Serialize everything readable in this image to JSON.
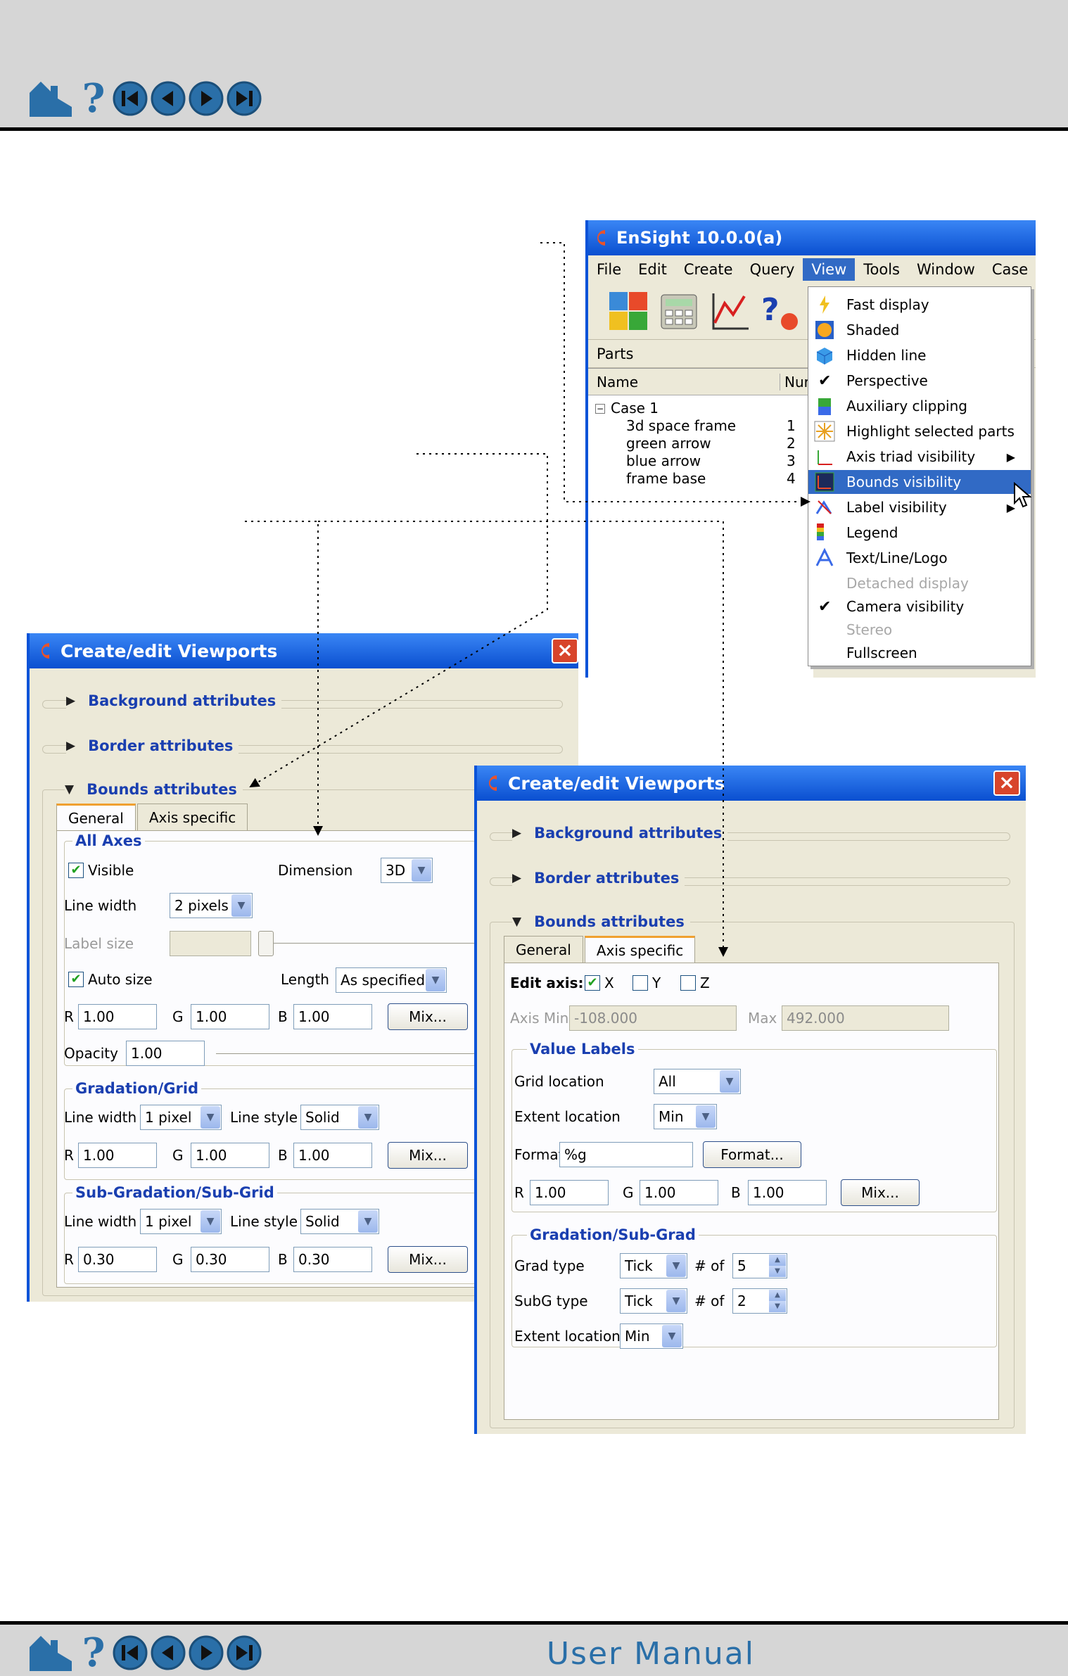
{
  "footer": {
    "title": "User Manual"
  },
  "ensight": {
    "title": "EnSight 10.0.0(a)",
    "menu": [
      "File",
      "Edit",
      "Create",
      "Query",
      "View",
      "Tools",
      "Window",
      "Case"
    ],
    "active_menu": "View",
    "parts_label": "Parts",
    "columns": {
      "name": "Name",
      "num": "Nur"
    },
    "tree": {
      "case": "Case 1",
      "parts": [
        {
          "name": "3d space frame",
          "num": "1"
        },
        {
          "name": "green arrow",
          "num": "2"
        },
        {
          "name": "blue arrow",
          "num": "3"
        },
        {
          "name": "frame base",
          "num": "4"
        }
      ]
    },
    "view_menu": [
      {
        "label": "Fast display",
        "icon": "lightning-icon"
      },
      {
        "label": "Shaded",
        "icon": "shaded-icon"
      },
      {
        "label": "Hidden line",
        "icon": "hidden-line-icon"
      },
      {
        "label": "Perspective",
        "check": "✔"
      },
      {
        "label": "Auxiliary clipping",
        "icon": "clipping-icon"
      },
      {
        "label": "Highlight selected parts",
        "icon": "highlight-icon"
      },
      {
        "label": "Axis triad visibility",
        "icon": "axis-triad-icon",
        "sub": "▶"
      },
      {
        "label": "Bounds visibility",
        "icon": "bounds-icon",
        "selected": true
      },
      {
        "label": "Label visibility",
        "icon": "label-icon",
        "sub": "▶"
      },
      {
        "label": "Legend",
        "icon": "legend-icon"
      },
      {
        "label": "Text/Line/Logo",
        "icon": "text-line-logo-icon"
      },
      {
        "label": "Detached display",
        "disabled": true
      },
      {
        "label": "Camera visibility",
        "check": "✔"
      },
      {
        "label": "Stereo",
        "disabled": true
      },
      {
        "label": "Fullscreen"
      }
    ]
  },
  "dialog_general": {
    "title": "Create/edit Viewports",
    "sections": {
      "background": "Background attributes",
      "border": "Border attributes",
      "bounds": "Bounds attributes"
    },
    "tabs": [
      "General",
      "Axis specific"
    ],
    "all_axes": {
      "title": "All Axes",
      "visible": "Visible",
      "dimension_label": "Dimension",
      "dimension": "3D",
      "line_width_label": "Line width",
      "line_width": "2 pixels",
      "label_size": "Label size",
      "auto_size": "Auto size",
      "length_label": "Length",
      "length": "As specified",
      "r": "1.00",
      "g": "1.00",
      "b": "1.00",
      "mix": "Mix...",
      "opacity_label": "Opacity",
      "opacity": "1.00"
    },
    "gradation": {
      "title": "Gradation/Grid",
      "line_width_label": "Line width",
      "line_width": "1 pixel",
      "line_style_label": "Line style",
      "line_style": "Solid",
      "r": "1.00",
      "g": "1.00",
      "b": "1.00",
      "mix": "Mix..."
    },
    "sub_gradation": {
      "title": "Sub-Gradation/Sub-Grid",
      "line_width_label": "Line width",
      "line_width": "1 pixel",
      "line_style_label": "Line style",
      "line_style": "Solid",
      "r": "0.30",
      "g": "0.30",
      "b": "0.30",
      "mix": "Mix..."
    }
  },
  "dialog_axis": {
    "title": "Create/edit Viewports",
    "sections": {
      "background": "Background attributes",
      "border": "Border attributes",
      "bounds": "Bounds attributes"
    },
    "tabs": [
      "General",
      "Axis specific"
    ],
    "edit_axis": "Edit axis:",
    "axes": [
      "X",
      "Y",
      "Z"
    ],
    "axis_min_label": "Axis Min",
    "axis_min": "-108.000",
    "max_label": "Max",
    "max": "492.000",
    "value_labels": {
      "title": "Value Labels",
      "grid_location_label": "Grid location",
      "grid_location": "All",
      "extent_location_label": "Extent location",
      "extent_location": "Min",
      "format_label": "Format",
      "format": "%g",
      "format_button": "Format...",
      "r": "1.00",
      "g": "1.00",
      "b": "1.00",
      "mix": "Mix..."
    },
    "gradation": {
      "title": "Gradation/Sub-Grad",
      "grad_type_label": "Grad type",
      "grad_type": "Tick",
      "of_label": "# of",
      "grad_count": "5",
      "subg_type_label": "SubG type",
      "subg_type": "Tick",
      "subg_count": "2",
      "extent_location_label": "Extent location",
      "extent_location": "Min"
    }
  },
  "labels": {
    "r": "R",
    "g": "G",
    "b": "B"
  }
}
